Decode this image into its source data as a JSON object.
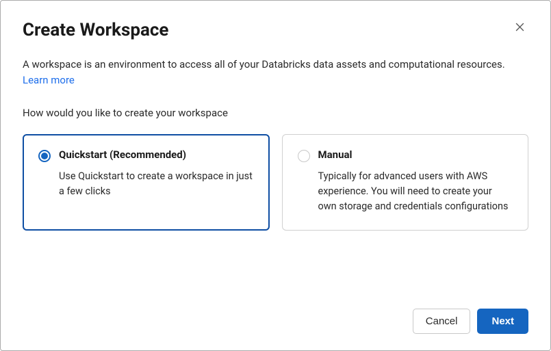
{
  "title": "Create Workspace",
  "description_text": "A workspace is an environment to access all of your Databricks data assets and computational resources. ",
  "learn_more_label": "Learn more",
  "prompt": "How would you like to create your workspace",
  "options": {
    "quickstart": {
      "title": "Quickstart (Recommended)",
      "description": "Use Quickstart to create a workspace in just a few clicks",
      "selected": true
    },
    "manual": {
      "title": "Manual",
      "description": "Typically for advanced users with AWS experience. You will need to create your own storage and credentials configurations",
      "selected": false
    }
  },
  "buttons": {
    "cancel": "Cancel",
    "next": "Next"
  }
}
